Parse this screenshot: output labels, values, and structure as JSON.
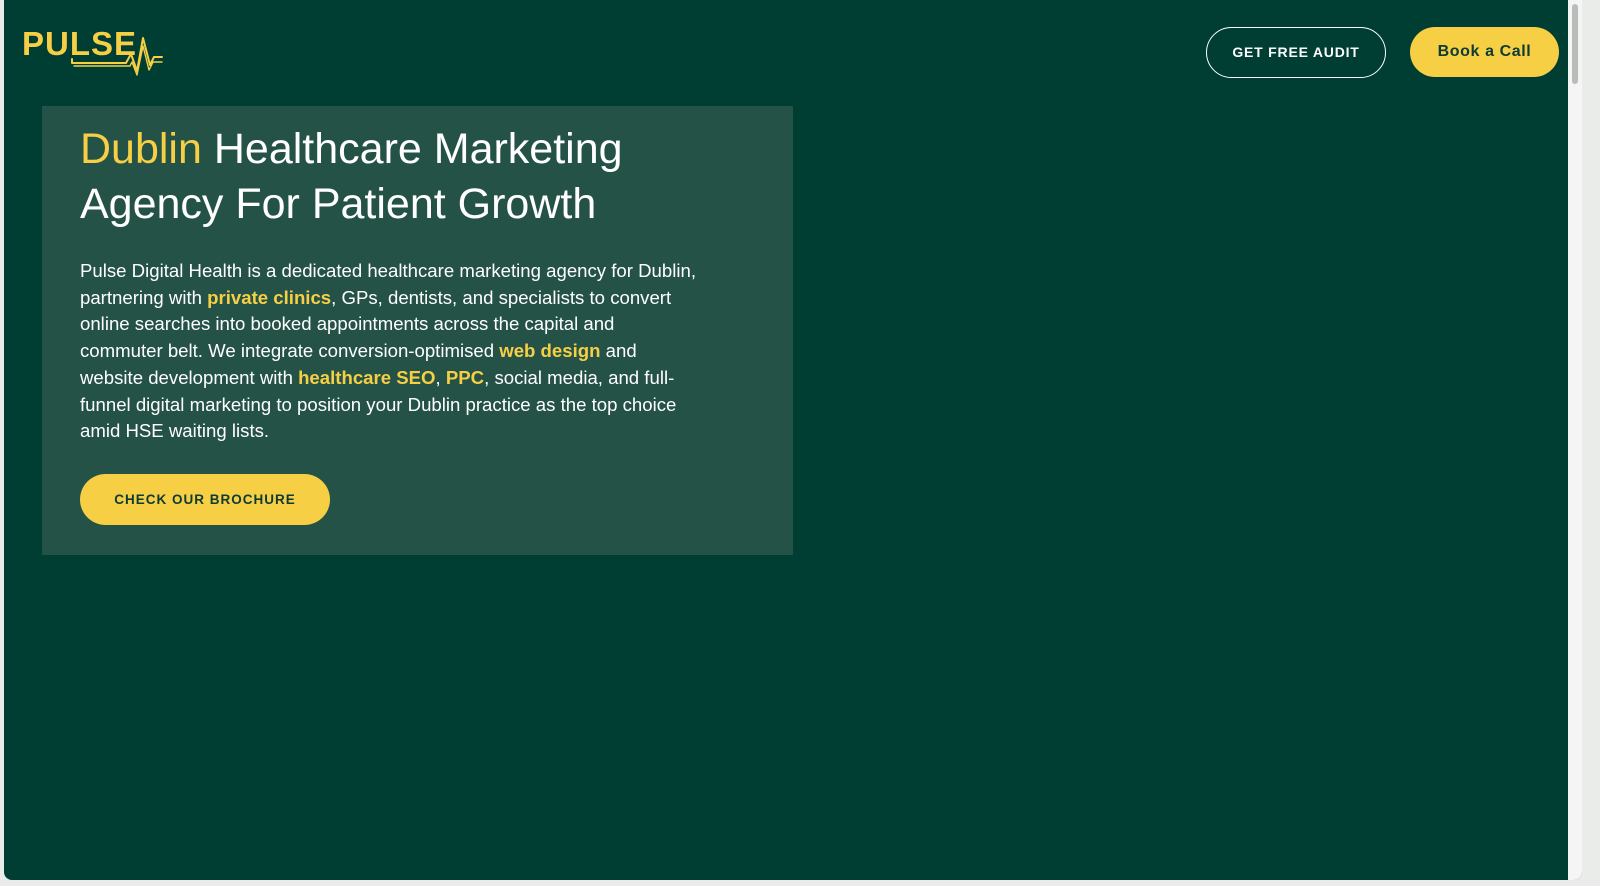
{
  "brand": {
    "logo_text": "PULSE",
    "logo_color": "#f6cf45",
    "background": "#003d33",
    "card_background": "#245247"
  },
  "header": {
    "audit_button": "GET FREE AUDIT",
    "call_button": "Book a Call"
  },
  "hero": {
    "title_accent": "Dublin",
    "title_rest": " Healthcare Marketing Agency For Patient Growth",
    "desc": {
      "p1": "Pulse Digital Health is a dedicated healthcare marketing agency for Dublin, partnering with ",
      "link1": "private clinics",
      "p2": ", GPs, dentists, and specialists to convert online searches into booked appointments across the capital and commuter belt. We integrate conversion-optimised ",
      "link2": "web design",
      "p3": " and website development with ",
      "link3": "healthcare SEO",
      "p4": ", ",
      "link4": "PPC",
      "p5": ", social media, and full-funnel digital marketing to position your Dublin practice as the top choice amid HSE waiting lists."
    },
    "cta_button": "CHECK OUR BROCHURE"
  }
}
